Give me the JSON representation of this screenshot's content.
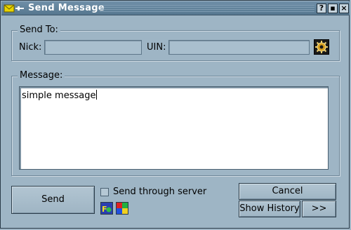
{
  "window": {
    "title": "Send Message",
    "help_button": "?",
    "minimize_button": "▪",
    "close_button": "×"
  },
  "send_to": {
    "group_label": "Send To:",
    "nick_label": "Nick:",
    "nick_value": "",
    "uin_label": "UIN:",
    "uin_value": ""
  },
  "message": {
    "group_label": "Message:",
    "text": "simple message"
  },
  "actions": {
    "send_label": "Send",
    "send_through_server_label": "Send through server",
    "send_through_server_checked": false,
    "cancel_label": "Cancel",
    "show_history_label": "Show History",
    "more_label": ">>"
  },
  "icons": {
    "title_icon": "envelope-icon",
    "user_info_icon": "gear-icon",
    "font_icon": "font-color-icon",
    "color_icon": "color-palette-icon"
  },
  "colors": {
    "background": "#9eb5c5",
    "titlebar": "#56778f",
    "accent_yellow": "#e8d400"
  }
}
